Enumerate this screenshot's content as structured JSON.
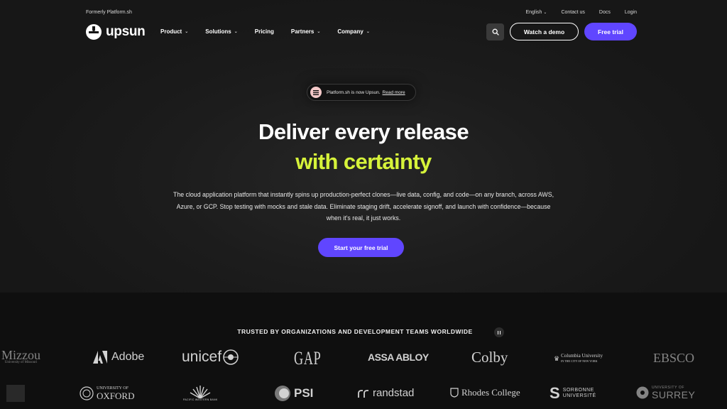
{
  "topbar": {
    "formerly": "Formerly Platform.sh",
    "language": "English",
    "contact": "Contact us",
    "docs": "Docs",
    "login": "Login"
  },
  "nav": {
    "logo_text": "upsun",
    "items": [
      {
        "label": "Product",
        "has_dropdown": true
      },
      {
        "label": "Solutions",
        "has_dropdown": true
      },
      {
        "label": "Pricing",
        "has_dropdown": false
      },
      {
        "label": "Partners",
        "has_dropdown": true
      },
      {
        "label": "Company",
        "has_dropdown": true
      }
    ],
    "search_icon": "search-icon",
    "demo_label": "Watch a demo",
    "trial_label": "Free trial"
  },
  "announcement": {
    "text": "Platform.sh is now Upsun.",
    "link": "Read more"
  },
  "hero": {
    "line1": "Deliver every release",
    "line2": "with certainty",
    "description": "The cloud application platform that instantly spins up production-perfect clones—live data, config, and code—on any branch, across AWS, Azure, or GCP. Stop testing with mocks and stale data. Eliminate staging drift, accelerate signoff, and launch with confidence—because when it’s real, it just works.",
    "cta": "Start your free trial"
  },
  "trusted": {
    "heading": "TRUSTED BY ORGANIZATIONS AND DEVELOPMENT TEAMS WORLDWIDE",
    "row1": [
      "Mizzou",
      "Adobe",
      "unicef",
      "GAP",
      "ASSA ABLOY",
      "Colby",
      "Columbia University",
      "EBSCO"
    ],
    "row1_sub": {
      "mizzou": "University of Missouri",
      "columbia": "IN THE CITY OF NEW YORK"
    },
    "row2": [
      "UNIVERSITY OF",
      "OXFORD",
      "PACIFIC WESTERN BANK",
      "PSI",
      "randstad",
      "Rhodes College",
      "SORBONNE",
      "UNIVERSITÉ",
      "UNIVERSITY OF",
      "SURREY"
    ]
  },
  "colors": {
    "accent": "#6046ff",
    "highlight": "#d6f33a",
    "background": "#151515"
  }
}
